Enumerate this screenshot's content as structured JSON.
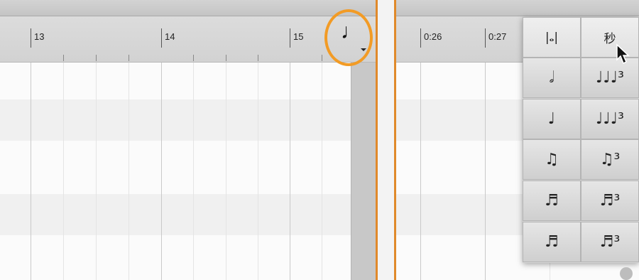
{
  "left": {
    "bar_labels": [
      "13",
      "14",
      "15"
    ],
    "note_value_button": {
      "glyph": "♩",
      "has_dropdown": true,
      "highlighted": true
    }
  },
  "right": {
    "time_labels": [
      "0:26",
      "0:27"
    ],
    "note_value_menu": {
      "items": [
        {
          "label": "|𝅝|",
          "column": "straight"
        },
        {
          "label": "秒",
          "column": "triplet",
          "selected": true
        },
        {
          "label": "𝅗𝅥",
          "column": "straight"
        },
        {
          "label": "♩♩♩³",
          "column": "triplet"
        },
        {
          "label": "♩",
          "column": "straight"
        },
        {
          "label": "♩♩♩³",
          "column": "triplet"
        },
        {
          "label": "♫",
          "column": "straight"
        },
        {
          "label": "♫³",
          "column": "triplet"
        },
        {
          "label": "♬",
          "column": "straight"
        },
        {
          "label": "♬³",
          "column": "triplet"
        },
        {
          "label": "♬",
          "column": "straight"
        },
        {
          "label": "♬³",
          "column": "triplet"
        }
      ]
    }
  },
  "colors": {
    "highlight": "#f29b25",
    "edge": "#e0892a"
  }
}
